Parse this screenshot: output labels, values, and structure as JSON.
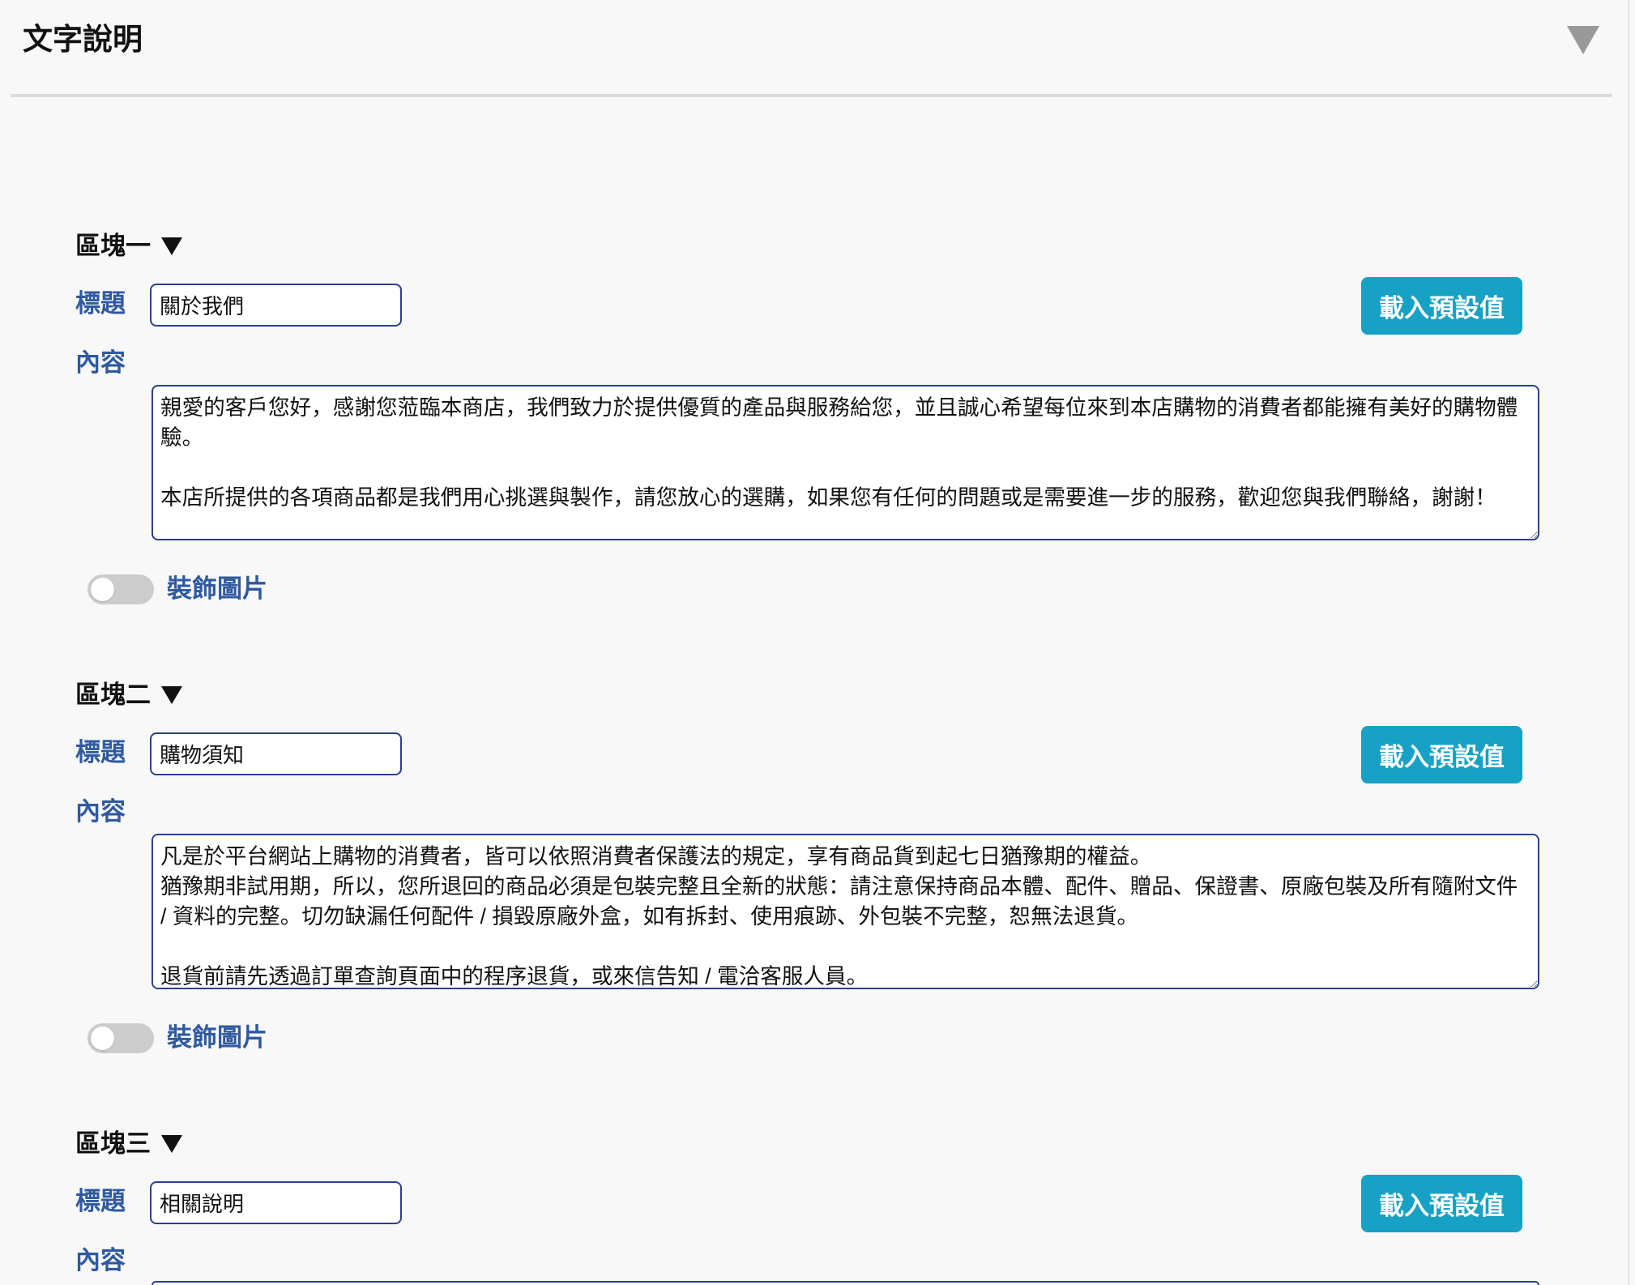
{
  "theme": {
    "background": "#f8f8f8",
    "label_color": "#2f5aa0",
    "field_border": "#2b3f8c",
    "button_bg": "#17a1c4",
    "switch_off": "#cccccc",
    "caret_gray": "#999999",
    "divider": "#dcdcdc"
  },
  "panel": {
    "title": "文字說明",
    "collapse_icon": "caret-down-icon"
  },
  "blocks": [
    {
      "heading": "區塊一",
      "toggle_icon": "caret-down-icon",
      "title_label": "標題",
      "title_value": "關於我們",
      "load_default_button": "載入預設值",
      "content_label": "內容",
      "content_value": "親愛的客戶您好，感謝您蒞臨本商店，我們致力於提供優質的產品與服務給您，並且誠心希望每位來到本店購物的消費者都能擁有美好的購物體驗。\n\n本店所提供的各項商品都是我們用心挑選與製作，請您放心的選購，如果您有任何的問題或是需要進一步的服務，歡迎您與我們聯絡，謝謝！",
      "decor_image_label": "裝飾圖片",
      "decor_image_enabled": false
    },
    {
      "heading": "區塊二",
      "toggle_icon": "caret-down-icon",
      "title_label": "標題",
      "title_value": "購物須知",
      "load_default_button": "載入預設值",
      "content_label": "內容",
      "content_value": "凡是於平台網站上購物的消費者，皆可以依照消費者保護法的規定，享有商品貨到起七日猶豫期的權益。\n猶豫期非試用期，所以，您所退回的商品必須是包裝完整且全新的狀態：請注意保持商品本體、配件、贈品、保證書、原廠包裝及所有隨附文件 / 資料的完整。切勿缺漏任何配件 / 損毀原廠外盒，如有拆封、使用痕跡、外包裝不完整，恕無法退貨。\n\n退貨前請先透過訂單查詢頁面中的程序退貨，或來信告知 / 電洽客服人員。",
      "decor_image_label": "裝飾圖片",
      "decor_image_enabled": false
    },
    {
      "heading": "區塊三",
      "toggle_icon": "caret-down-icon",
      "title_label": "標題",
      "title_value": "相關說明",
      "load_default_button": "載入預設值",
      "content_label": "內容"
    }
  ]
}
